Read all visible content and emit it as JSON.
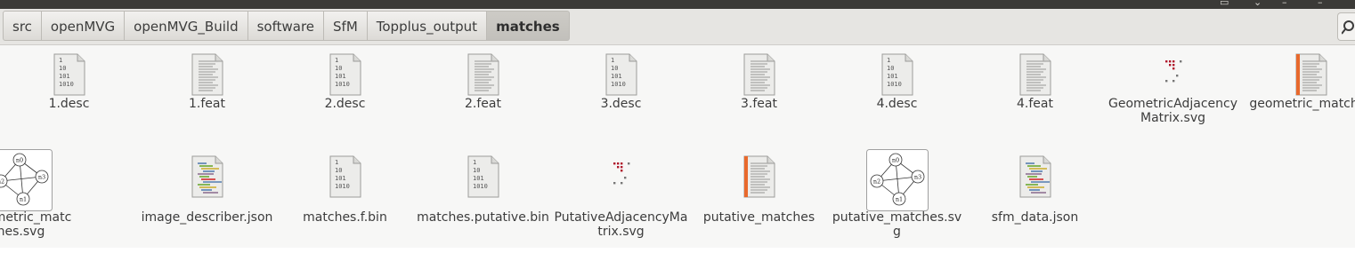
{
  "path": {
    "crumbs": [
      "src",
      "openMVG",
      "openMVG_Build",
      "software",
      "SfM",
      "Topplus_output",
      "matches"
    ],
    "active_index": 6
  },
  "files": [
    {
      "name": "1.desc",
      "icon": "binary"
    },
    {
      "name": "1.feat",
      "icon": "text"
    },
    {
      "name": "2.desc",
      "icon": "binary"
    },
    {
      "name": "2.feat",
      "icon": "text"
    },
    {
      "name": "3.desc",
      "icon": "binary"
    },
    {
      "name": "3.feat",
      "icon": "text"
    },
    {
      "name": "4.desc",
      "icon": "binary"
    },
    {
      "name": "4.feat",
      "icon": "text"
    },
    {
      "name": "GeometricAdjacencyMatrix.svg",
      "icon": "matrix"
    },
    {
      "name": "geometric_matches",
      "icon": "orange-doc"
    },
    {
      "name": "geometric_matches.svg",
      "icon": "graph"
    },
    {
      "name": "image_describer.json",
      "icon": "code"
    },
    {
      "name": "matches.f.bin",
      "icon": "binary"
    },
    {
      "name": "matches.putative.bin",
      "icon": "binary"
    },
    {
      "name": "PutativeAdjacencyMatrix.svg",
      "icon": "matrix"
    },
    {
      "name": "putative_matches",
      "icon": "orange-doc"
    },
    {
      "name": "putative_matches.svg",
      "icon": "graph"
    },
    {
      "name": "sfm_data.json",
      "icon": "code"
    }
  ],
  "graph_nodes": [
    "n0",
    "n1",
    "n2",
    "n3"
  ],
  "binary_lines": [
    "1",
    "10",
    "101",
    "1010"
  ],
  "colors": {
    "toolbar_dark": "#3b3a37",
    "pathbar": "#e6e5e2",
    "active_crumb": "#c6c4bf",
    "orange_accent": "#e8692c",
    "matrix_red": "#b0182c"
  }
}
